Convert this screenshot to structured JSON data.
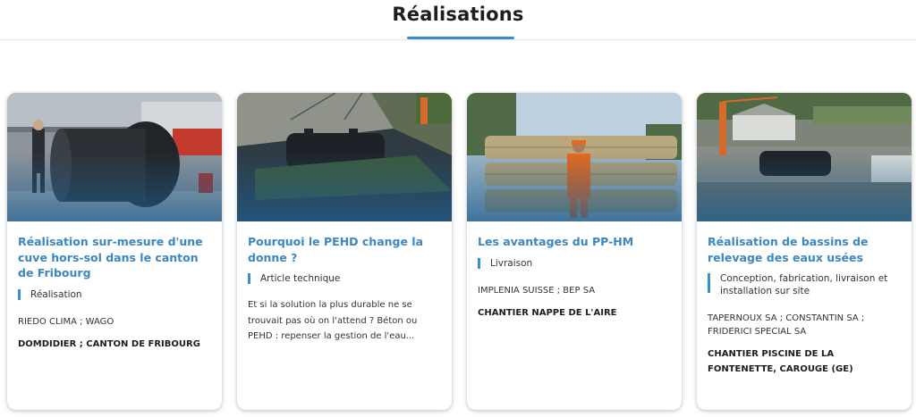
{
  "header": {
    "title": "Réalisations"
  },
  "cards": [
    {
      "title": "Réalisation sur-mesure d'une cuve hors-sol dans le canton de Fribourg",
      "tag": "Réalisation",
      "meta": "RIEDO CLIMA ; WAGO",
      "location": "DOMDIDIER ; CANTON DE FRIBOURG"
    },
    {
      "title": "Pourquoi le PEHD change la donne ?",
      "tag": "Article technique",
      "excerpt": "Et si la solution la plus durable ne se trouvait pas où on l'attend ? Béton ou PEHD : repenser la gestion de l'eau..."
    },
    {
      "title": "Les avantages du PP-HM",
      "tag": "Livraison",
      "meta": "IMPLENIA SUISSE ; BEP SA",
      "location": "CHANTIER NAPPE DE L'AIRE"
    },
    {
      "title": "Réalisation de bassins de relevage des eaux usées",
      "tag": "Conception, fabrication, livraison et installation sur site",
      "meta": "TAPERNOUX SA ; CONSTANTIN SA ; FRIDERICI SPECIAL SA",
      "location": "CHANTIER PISCINE DE LA FONTENETTE, CAROUGE (GE)"
    }
  ]
}
